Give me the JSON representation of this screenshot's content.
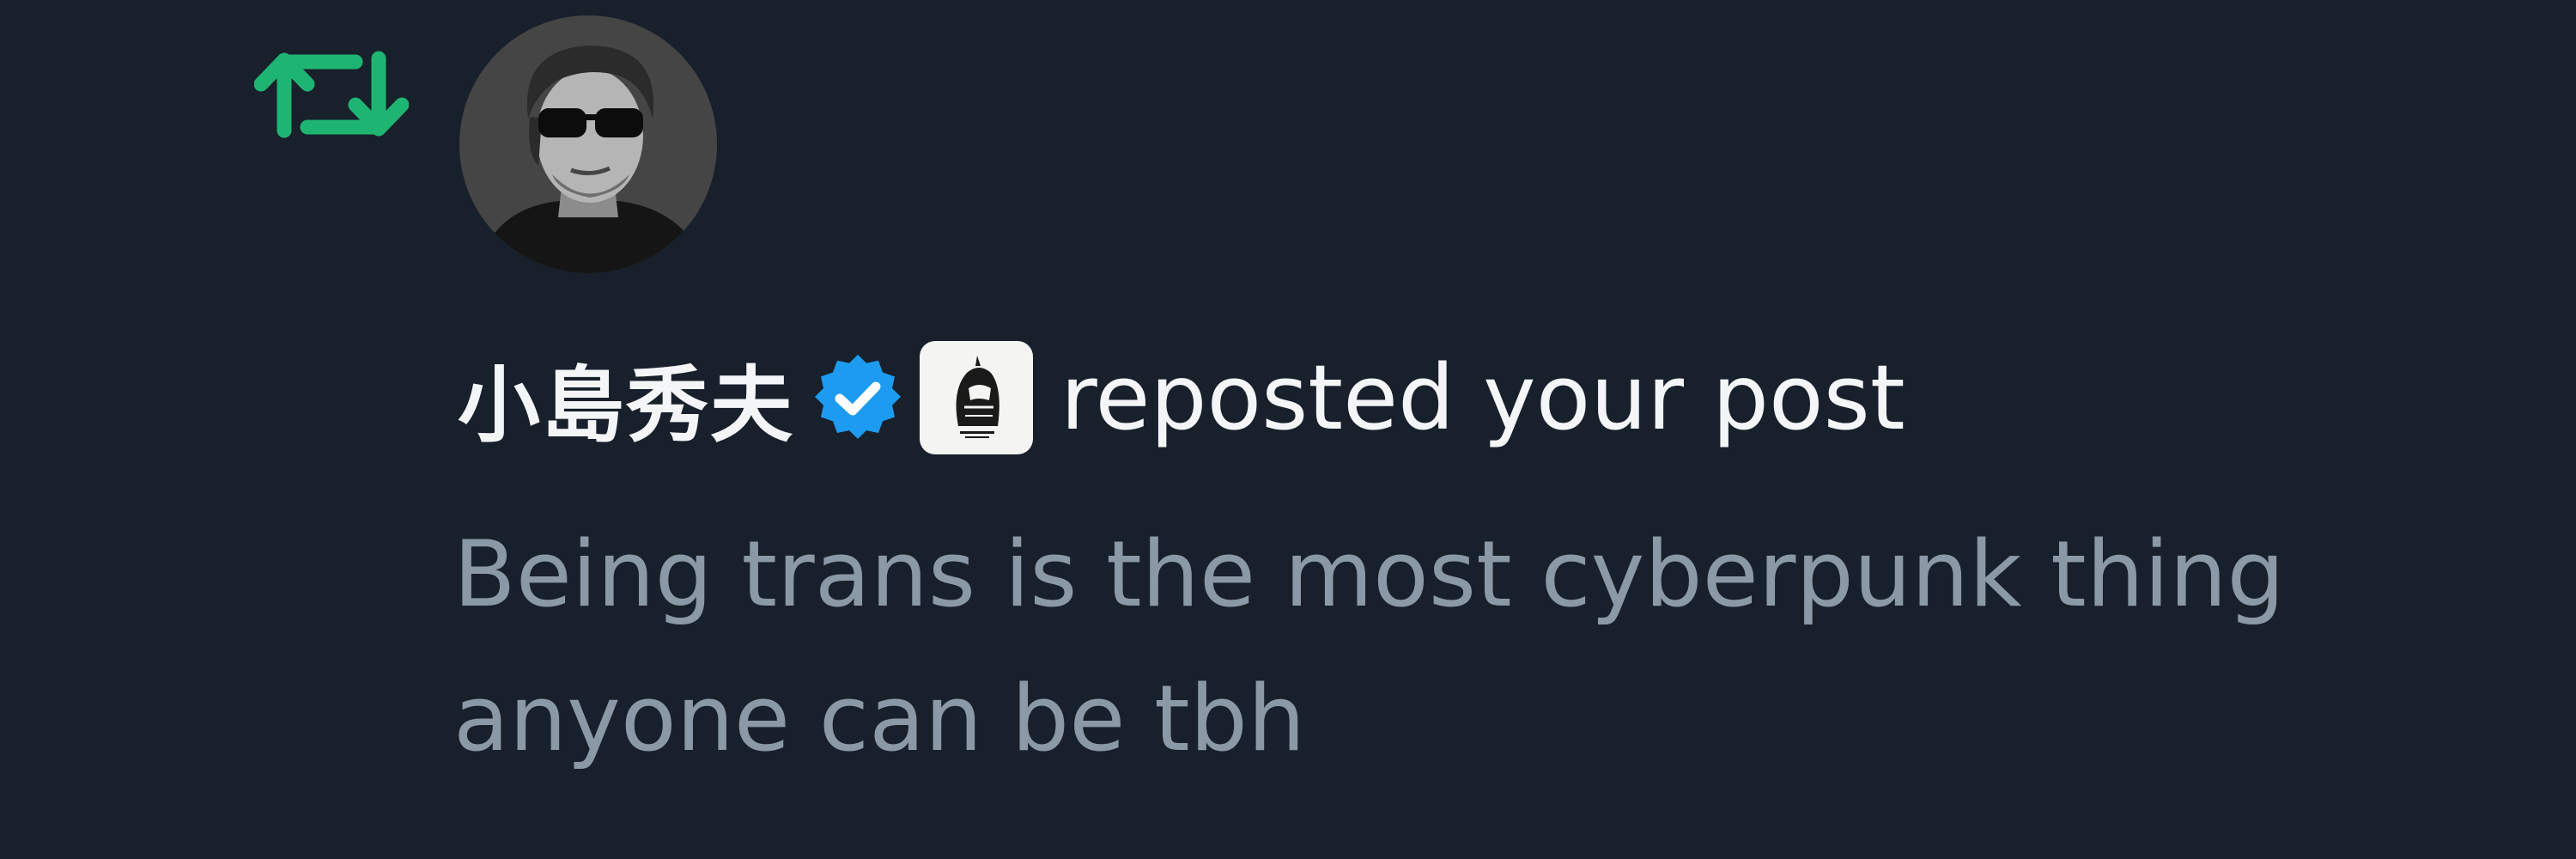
{
  "notification": {
    "user": {
      "display_name": "小島秀夫",
      "verified_icon": "verified-badge-icon",
      "affiliate_icon": "kojima-productions-logo"
    },
    "action_text": "reposted your post",
    "post": {
      "lines": [
        "Being trans is the most cyberpunk thing",
        "anyone can be tbh"
      ]
    },
    "icons": {
      "repost": "repost-icon"
    }
  },
  "colors": {
    "background": "#18202b",
    "repost_green": "#1eb572",
    "verified_blue": "#1d9bf0",
    "primary_text": "#f3f5f7",
    "secondary_text": "#8b98a5"
  }
}
